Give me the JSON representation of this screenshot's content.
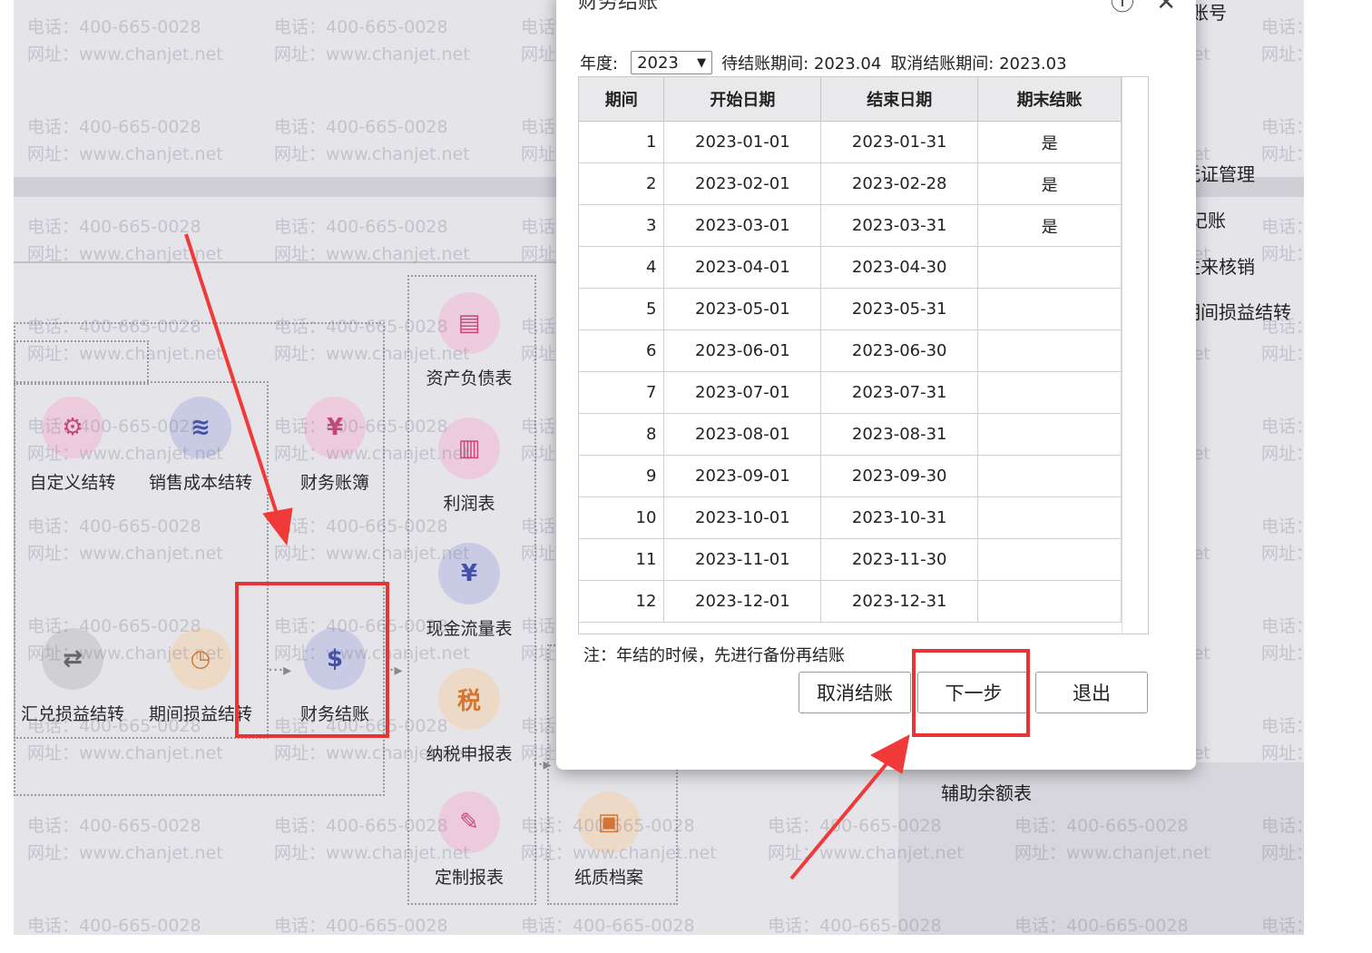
{
  "watermark": {
    "phone": "电话：400-665-0028",
    "site": "网址：www.chanjet.net"
  },
  "background": {
    "modules": [
      {
        "label": "资产负债表",
        "icon": "balance-sheet-icon",
        "color": "pink"
      },
      {
        "label": "自定义结转",
        "icon": "custom-transfer-icon",
        "color": "pink"
      },
      {
        "label": "销售成本结转",
        "icon": "sales-cost-icon",
        "color": "blue"
      },
      {
        "label": "财务账簿",
        "icon": "ledger-icon",
        "color": "pink"
      },
      {
        "label": "利润表",
        "icon": "profit-chart-icon",
        "color": "pink"
      },
      {
        "label": "现金流量表",
        "icon": "cash-flow-icon",
        "color": "blue"
      },
      {
        "label": "汇兑损益结转",
        "icon": "exchange-icon",
        "color": "grey"
      },
      {
        "label": "期间损益结转",
        "icon": "calendar-clock-icon",
        "color": "orange"
      },
      {
        "label": "财务结账",
        "icon": "money-close-icon",
        "color": "blue"
      },
      {
        "label": "纳税申报表",
        "icon": "tax-icon",
        "color": "orange"
      },
      {
        "label": "定制报表",
        "icon": "custom-report-icon",
        "color": "pink"
      },
      {
        "label": "纸质档案",
        "icon": "archive-icon",
        "color": "orange"
      }
    ],
    "side_menu": [
      "凭证管理",
      "记账",
      "往来核销",
      "期间损益结转"
    ],
    "side_fragments": {
      "top": "账号",
      "bottom": "辅助余额表"
    }
  },
  "dialog": {
    "title": "财务结账",
    "year_label": "年度:",
    "year_value": "2023",
    "pending_label": "待结账期间: 2023.04",
    "cancel_label": "取消结账期间: 2023.03",
    "columns": [
      "期间",
      "开始日期",
      "结束日期",
      "期末结账"
    ],
    "rows": [
      {
        "period": "1",
        "start": "2023-01-01",
        "end": "2023-01-31",
        "closed": "是"
      },
      {
        "period": "2",
        "start": "2023-02-01",
        "end": "2023-02-28",
        "closed": "是"
      },
      {
        "period": "3",
        "start": "2023-03-01",
        "end": "2023-03-31",
        "closed": "是"
      },
      {
        "period": "4",
        "start": "2023-04-01",
        "end": "2023-04-30",
        "closed": ""
      },
      {
        "period": "5",
        "start": "2023-05-01",
        "end": "2023-05-31",
        "closed": ""
      },
      {
        "period": "6",
        "start": "2023-06-01",
        "end": "2023-06-30",
        "closed": ""
      },
      {
        "period": "7",
        "start": "2023-07-01",
        "end": "2023-07-31",
        "closed": ""
      },
      {
        "period": "8",
        "start": "2023-08-01",
        "end": "2023-08-31",
        "closed": ""
      },
      {
        "period": "9",
        "start": "2023-09-01",
        "end": "2023-09-30",
        "closed": ""
      },
      {
        "period": "10",
        "start": "2023-10-01",
        "end": "2023-10-31",
        "closed": ""
      },
      {
        "period": "11",
        "start": "2023-11-01",
        "end": "2023-11-30",
        "closed": ""
      },
      {
        "period": "12",
        "start": "2023-12-01",
        "end": "2023-12-31",
        "closed": ""
      }
    ],
    "note": "注：年结的时候，先进行备份再结账",
    "buttons": {
      "cancel_close": "取消结账",
      "next": "下一步",
      "exit": "退出"
    }
  },
  "colors": {
    "highlight": "#e53535",
    "arrow": "#f03a3a"
  }
}
